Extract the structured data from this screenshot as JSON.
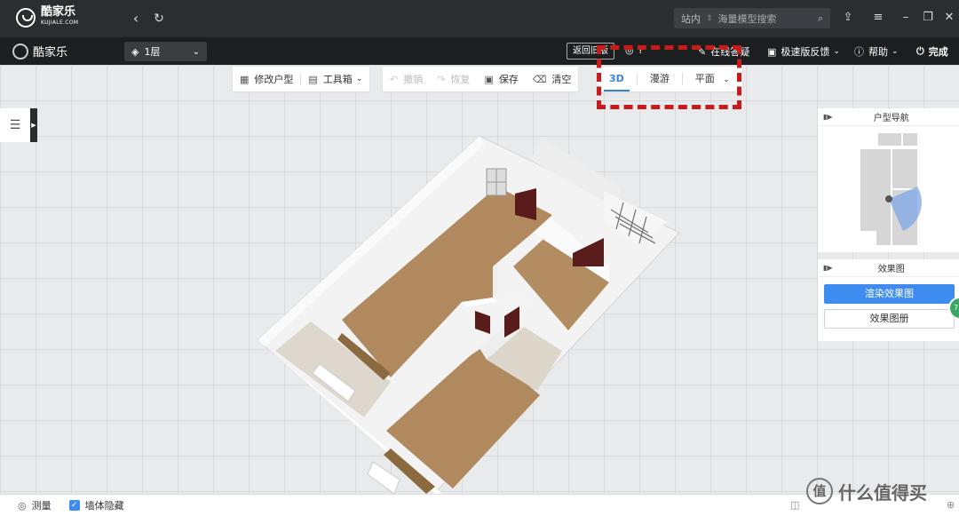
{
  "app": {
    "logo_cn": "酷家乐",
    "logo_en": "KUJIALE.COM"
  },
  "titlebar": {
    "search_scope": "站内",
    "search_placeholder": "海量模型搜索"
  },
  "toolbar": {
    "logo_text": "酷家乐",
    "floor": "1层",
    "back_old": "返回旧版",
    "item_partial_1": "?",
    "item_partial_2": "在线答疑",
    "feedback": "极速版反馈",
    "help": "帮助",
    "done": "完成"
  },
  "tools": {
    "edit_floorplan": "修改户型",
    "toolbox": "工具箱",
    "undo": "撤销",
    "redo": "恢复",
    "save": "保存",
    "clear": "清空"
  },
  "views": {
    "tab_3d": "3D",
    "tab_roam": "漫游",
    "tab_plan": "平面"
  },
  "panels": {
    "nav_title": "户型导航",
    "render_title": "效果图",
    "render_button": "渲染效果图",
    "album_button": "效果图册"
  },
  "statusbar": {
    "measure": "测量",
    "hide_walls": "墙体隐藏",
    "hide_walls_checked": true
  },
  "watermark": "值 什么值得买",
  "colors": {
    "accent": "#3f8cf0",
    "annotation": "#c81b1b",
    "floor_wood": "#b08a5e",
    "titlebar": "#2b2d30"
  }
}
